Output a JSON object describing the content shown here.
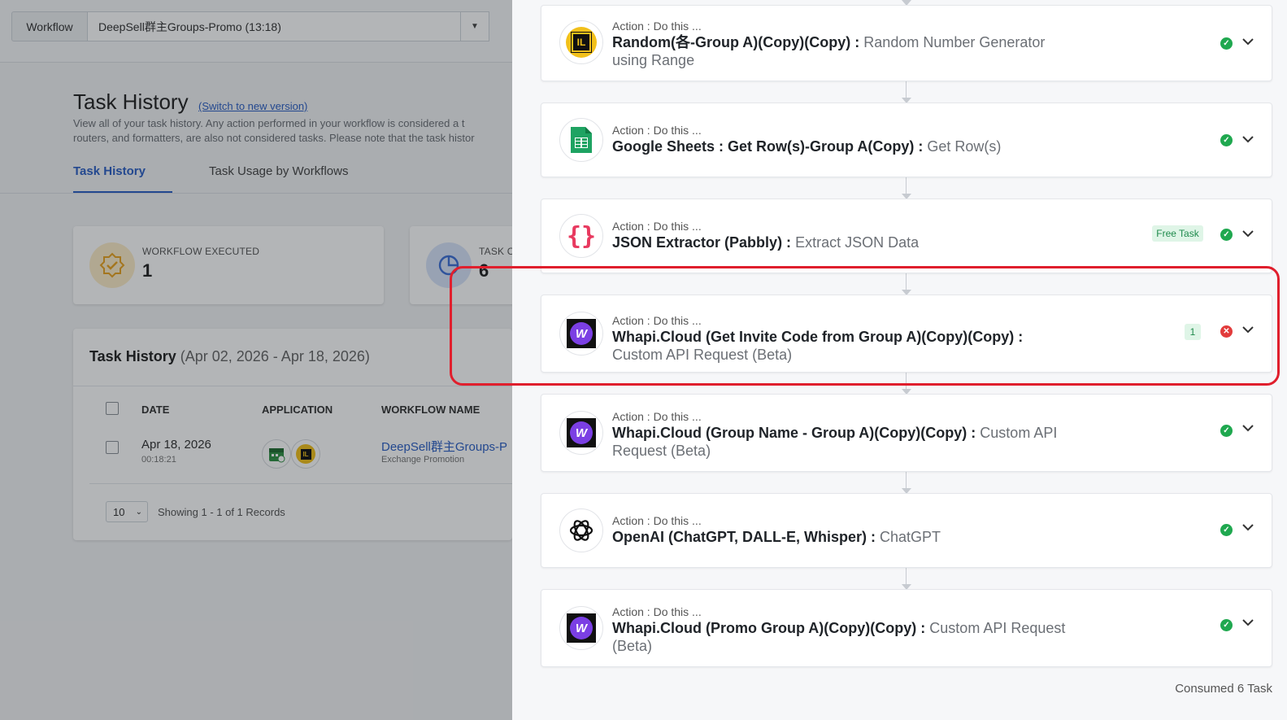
{
  "topbar": {
    "workflow_label": "Workflow",
    "workflow_selected": "DeepSell群主Groups-Promo (13:18)"
  },
  "page": {
    "title": "Task History",
    "switch_link": "(Switch to new version)",
    "description_line1": "View all of your task history. Any action performed in your workflow is considered a t",
    "description_line2": "routers, and formatters, are also not considered tasks. Please note that the task histor"
  },
  "tabs": [
    {
      "label": "Task History",
      "active": true
    },
    {
      "label": "Task Usage by Workflows",
      "active": false
    }
  ],
  "stats": [
    {
      "label": "WORKFLOW EXECUTED",
      "value": "1",
      "icon": "badge-check-icon",
      "color": "#e9a21f"
    },
    {
      "label": "TASK C",
      "value": "6",
      "icon": "pie-chart-icon",
      "color": "#3d6fd6"
    }
  ],
  "history": {
    "title": "Task History",
    "range": "(Apr 02, 2026 - Apr 18, 2026)",
    "columns": [
      "DATE",
      "APPLICATION",
      "WORKFLOW NAME"
    ],
    "rows": [
      {
        "date": "Apr 18, 2026",
        "time": "00:18:21",
        "workflow": "DeepSell群主Groups-P",
        "workflow_sub": "Exchange Promotion"
      }
    ],
    "per_page": "10",
    "showing": "Showing 1 - 1 of 1 Records"
  },
  "steps": [
    {
      "kicker": "Action : Do this ...",
      "app": "Random(各-Group A)(Copy)(Copy) :",
      "action": "Random Number Generator using Range",
      "icon": "random-number-icon",
      "status": "success",
      "badge": ""
    },
    {
      "kicker": "Action : Do this ...",
      "app": "Google Sheets : Get Row(s)-Group A(Copy) :",
      "action": "Get Row(s)",
      "icon": "google-sheets-icon",
      "status": "success",
      "badge": ""
    },
    {
      "kicker": "Action : Do this ...",
      "app": "JSON Extractor (Pabbly) :",
      "action": "Extract JSON Data",
      "icon": "json-braces-icon",
      "status": "success",
      "badge": "Free Task"
    },
    {
      "kicker": "Action : Do this ...",
      "app": "Whapi.Cloud (Get Invite Code from Group A)(Copy)(Copy) :",
      "action": "Custom API Request (Beta)",
      "icon": "whapi-icon",
      "status": "error",
      "badge": "1"
    },
    {
      "kicker": "Action : Do this ...",
      "app": "Whapi.Cloud (Group Name - Group A)(Copy)(Copy) :",
      "action": "Custom API Request (Beta)",
      "icon": "whapi-icon",
      "status": "success",
      "badge": ""
    },
    {
      "kicker": "Action : Do this ...",
      "app": "OpenAI (ChatGPT, DALL-E, Whisper) :",
      "action": "ChatGPT",
      "icon": "openai-icon",
      "status": "success",
      "badge": ""
    },
    {
      "kicker": "Action : Do this ...",
      "app": "Whapi.Cloud (Promo Group A)(Copy)(Copy) :",
      "action": "Custom API Request (Beta)",
      "icon": "whapi-icon",
      "status": "success",
      "badge": ""
    }
  ],
  "consumed": "Consumed 6 Task",
  "colors": {
    "accent": "#2c5fc4",
    "success": "#1fa84f",
    "error": "#e23b3b",
    "highlight": "#e01f2d"
  }
}
